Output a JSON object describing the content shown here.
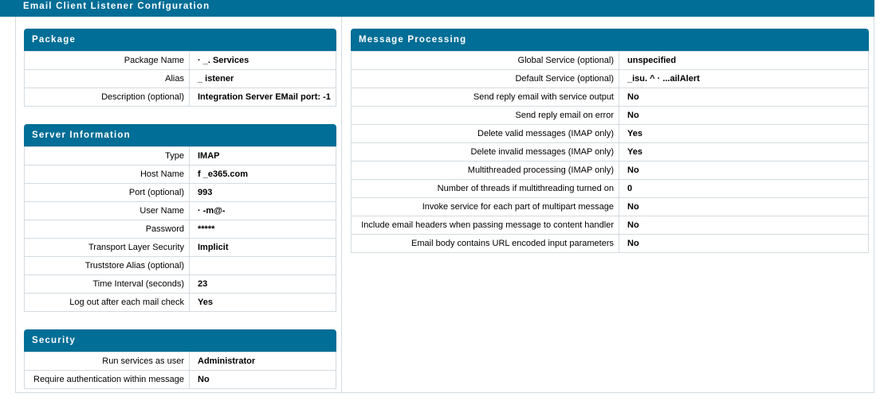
{
  "page_title": "Email Client Listener Configuration",
  "package": {
    "title": "Package",
    "rows": [
      {
        "label": "Package Name",
        "value": "·   _.         Services"
      },
      {
        "label": "Alias",
        "value": "_ istener"
      },
      {
        "label": "Description (optional)",
        "value": "Integration Server EMail port: -1"
      }
    ]
  },
  "server": {
    "title": "Server Information",
    "rows": [
      {
        "label": "Type",
        "value": "IMAP"
      },
      {
        "label": "Host Name",
        "value": "f  _e365.com"
      },
      {
        "label": "Port (optional)",
        "value": "993"
      },
      {
        "label": "User Name",
        "value": "·  -m@-"
      },
      {
        "label": "Password",
        "value": "*****"
      },
      {
        "label": "Transport Layer Security",
        "value": "Implicit"
      },
      {
        "label": "Truststore Alias (optional)",
        "value": ""
      },
      {
        "label": "Time Interval (seconds)",
        "value": "23"
      },
      {
        "label": "Log out after each mail check",
        "value": "Yes"
      }
    ]
  },
  "security": {
    "title": "Security",
    "rows": [
      {
        "label": "Run services as user",
        "value": "Administrator"
      },
      {
        "label": "Require authentication within message",
        "value": "No"
      }
    ]
  },
  "message_processing": {
    "title": "Message Processing",
    "rows": [
      {
        "label": "Global Service (optional)",
        "value": "unspecified"
      },
      {
        "label": "Default Service (optional)",
        "value": "_isu.    ^   ·                                                    ...ailAlert"
      },
      {
        "label": "Send reply email with service output",
        "value": "No"
      },
      {
        "label": "Send reply email on error",
        "value": "No"
      },
      {
        "label": "Delete valid messages (IMAP only)",
        "value": "Yes"
      },
      {
        "label": "Delete invalid messages (IMAP only)",
        "value": "Yes"
      },
      {
        "label": "Multithreaded processing (IMAP only)",
        "value": "No"
      },
      {
        "label": "Number of threads if multithreading turned on",
        "value": "0"
      },
      {
        "label": "Invoke service for each part of multipart message",
        "value": "No"
      },
      {
        "label": "Include email headers when passing message to content handler",
        "value": "No"
      },
      {
        "label": "Email body contains URL encoded input parameters",
        "value": "No"
      }
    ]
  }
}
